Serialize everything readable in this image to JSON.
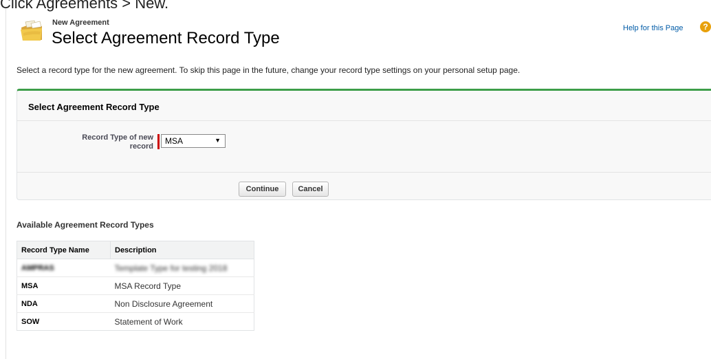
{
  "caption": {
    "text": "Click Agreements > New."
  },
  "header": {
    "subtitle": "New Agreement",
    "title": "Select Agreement Record Type",
    "help_link": "Help for this Page",
    "help_icon": "?",
    "icon": "agreement-folder-icon"
  },
  "intro": "Select a record type for the new agreement. To skip this page in the future, change your record type settings on your personal setup page.",
  "panel": {
    "title": "Select Agreement Record Type",
    "field_label_line1": "Record Type of new",
    "field_label_line2": "record",
    "selected_value": "MSA",
    "dropdown_arrow": "▼",
    "continue_label": "Continue",
    "cancel_label": "Cancel",
    "accent_color": "#3d9e49",
    "required_color": "#cc0000"
  },
  "available": {
    "heading": "Available Agreement Record Types",
    "columns": [
      "Record Type Name",
      "Description"
    ],
    "rows": [
      {
        "name": "AMPRAS",
        "description": "Template Type for testing 2018"
      },
      {
        "name": "MSA",
        "description": "MSA Record Type"
      },
      {
        "name": "NDA",
        "description": "Non Disclosure Agreement"
      },
      {
        "name": "SOW",
        "description": "Statement of Work"
      }
    ]
  }
}
